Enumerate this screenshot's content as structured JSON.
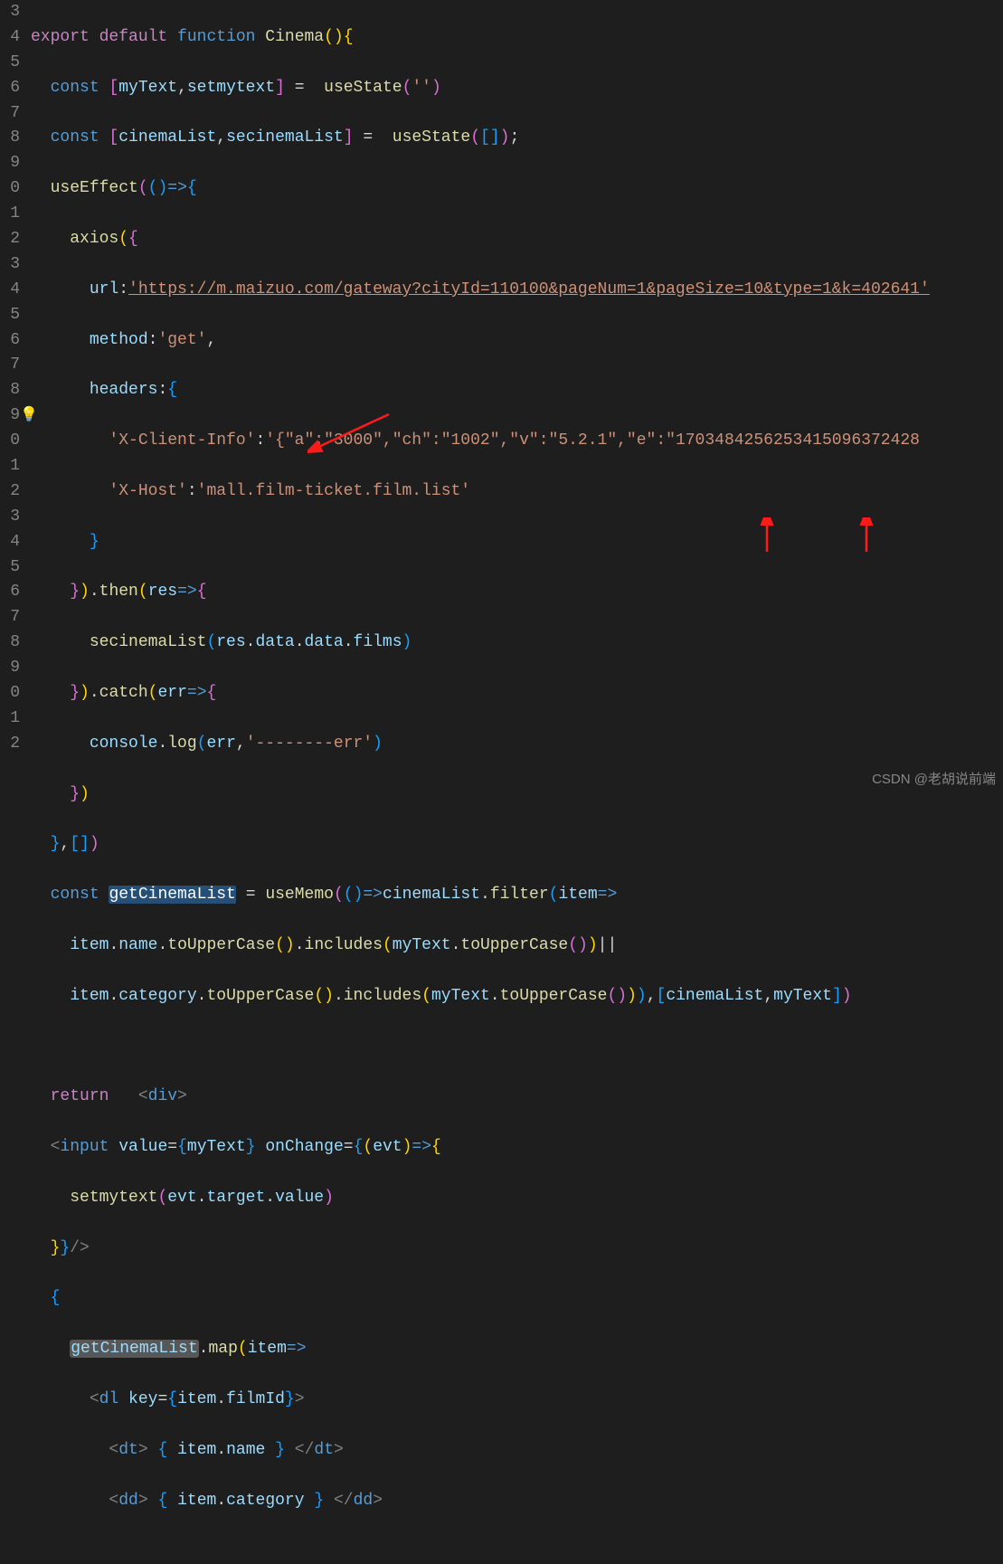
{
  "gutter": [
    "3",
    "4",
    "5",
    "6",
    "7",
    "8",
    "9",
    "0",
    "1",
    "2",
    "3",
    "4",
    "5",
    "6",
    "7",
    "8",
    "9",
    "0",
    "1",
    "2",
    "3",
    "4",
    "5",
    "6",
    "7",
    "8",
    "9",
    "0",
    "1",
    "2"
  ],
  "tokens": {
    "export": "export",
    "default": "default",
    "function": "function",
    "Cinema": "Cinema",
    "const": "const",
    "return": "return",
    "myText": "myText",
    "setmytext": "setmytext",
    "useState": "useState",
    "empty": "''",
    "arr": "[]",
    "cinemaList": "cinemaList",
    "secinemaList": "secinemaList",
    "useEffect": "useEffect",
    "axios": "axios",
    "url": "url",
    "urlval": "'https://m.maizuo.com/gateway?cityId=110100&pageNum=1&pageSize=10&type=1&k=402641'",
    "method": "method",
    "get": "'get'",
    "headers": "headers",
    "xci": "'X-Client-Info'",
    "xciv": "'{\"a\":\"3000\",\"ch\":\"1002\",\"v\":\"5.2.1\",\"e\":\"1703484256253415096372428",
    "xh": "'X-Host'",
    "xhv": "'mall.film-ticket.film.list'",
    "then": "then",
    "res": "res",
    "data": "data",
    "films": "films",
    "catch": "catch",
    "err": "err",
    "console": "console",
    "log": "log",
    "errstr": "'--------err'",
    "getCinemaList": "getCinemaList",
    "useMemo": "useMemo",
    "filter": "filter",
    "item": "item",
    "name": "name",
    "toUpperCase": "toUpperCase",
    "includes": "includes",
    "category": "category",
    "div": "div",
    "input": "input",
    "value": "value",
    "onChange": "onChange",
    "evt": "evt",
    "target": "target",
    "map": "map",
    "dl": "dl",
    "key": "key",
    "filmId": "filmId",
    "dt": "dt",
    "dd": "dd"
  },
  "watermark": "CSDN @老胡说前端"
}
